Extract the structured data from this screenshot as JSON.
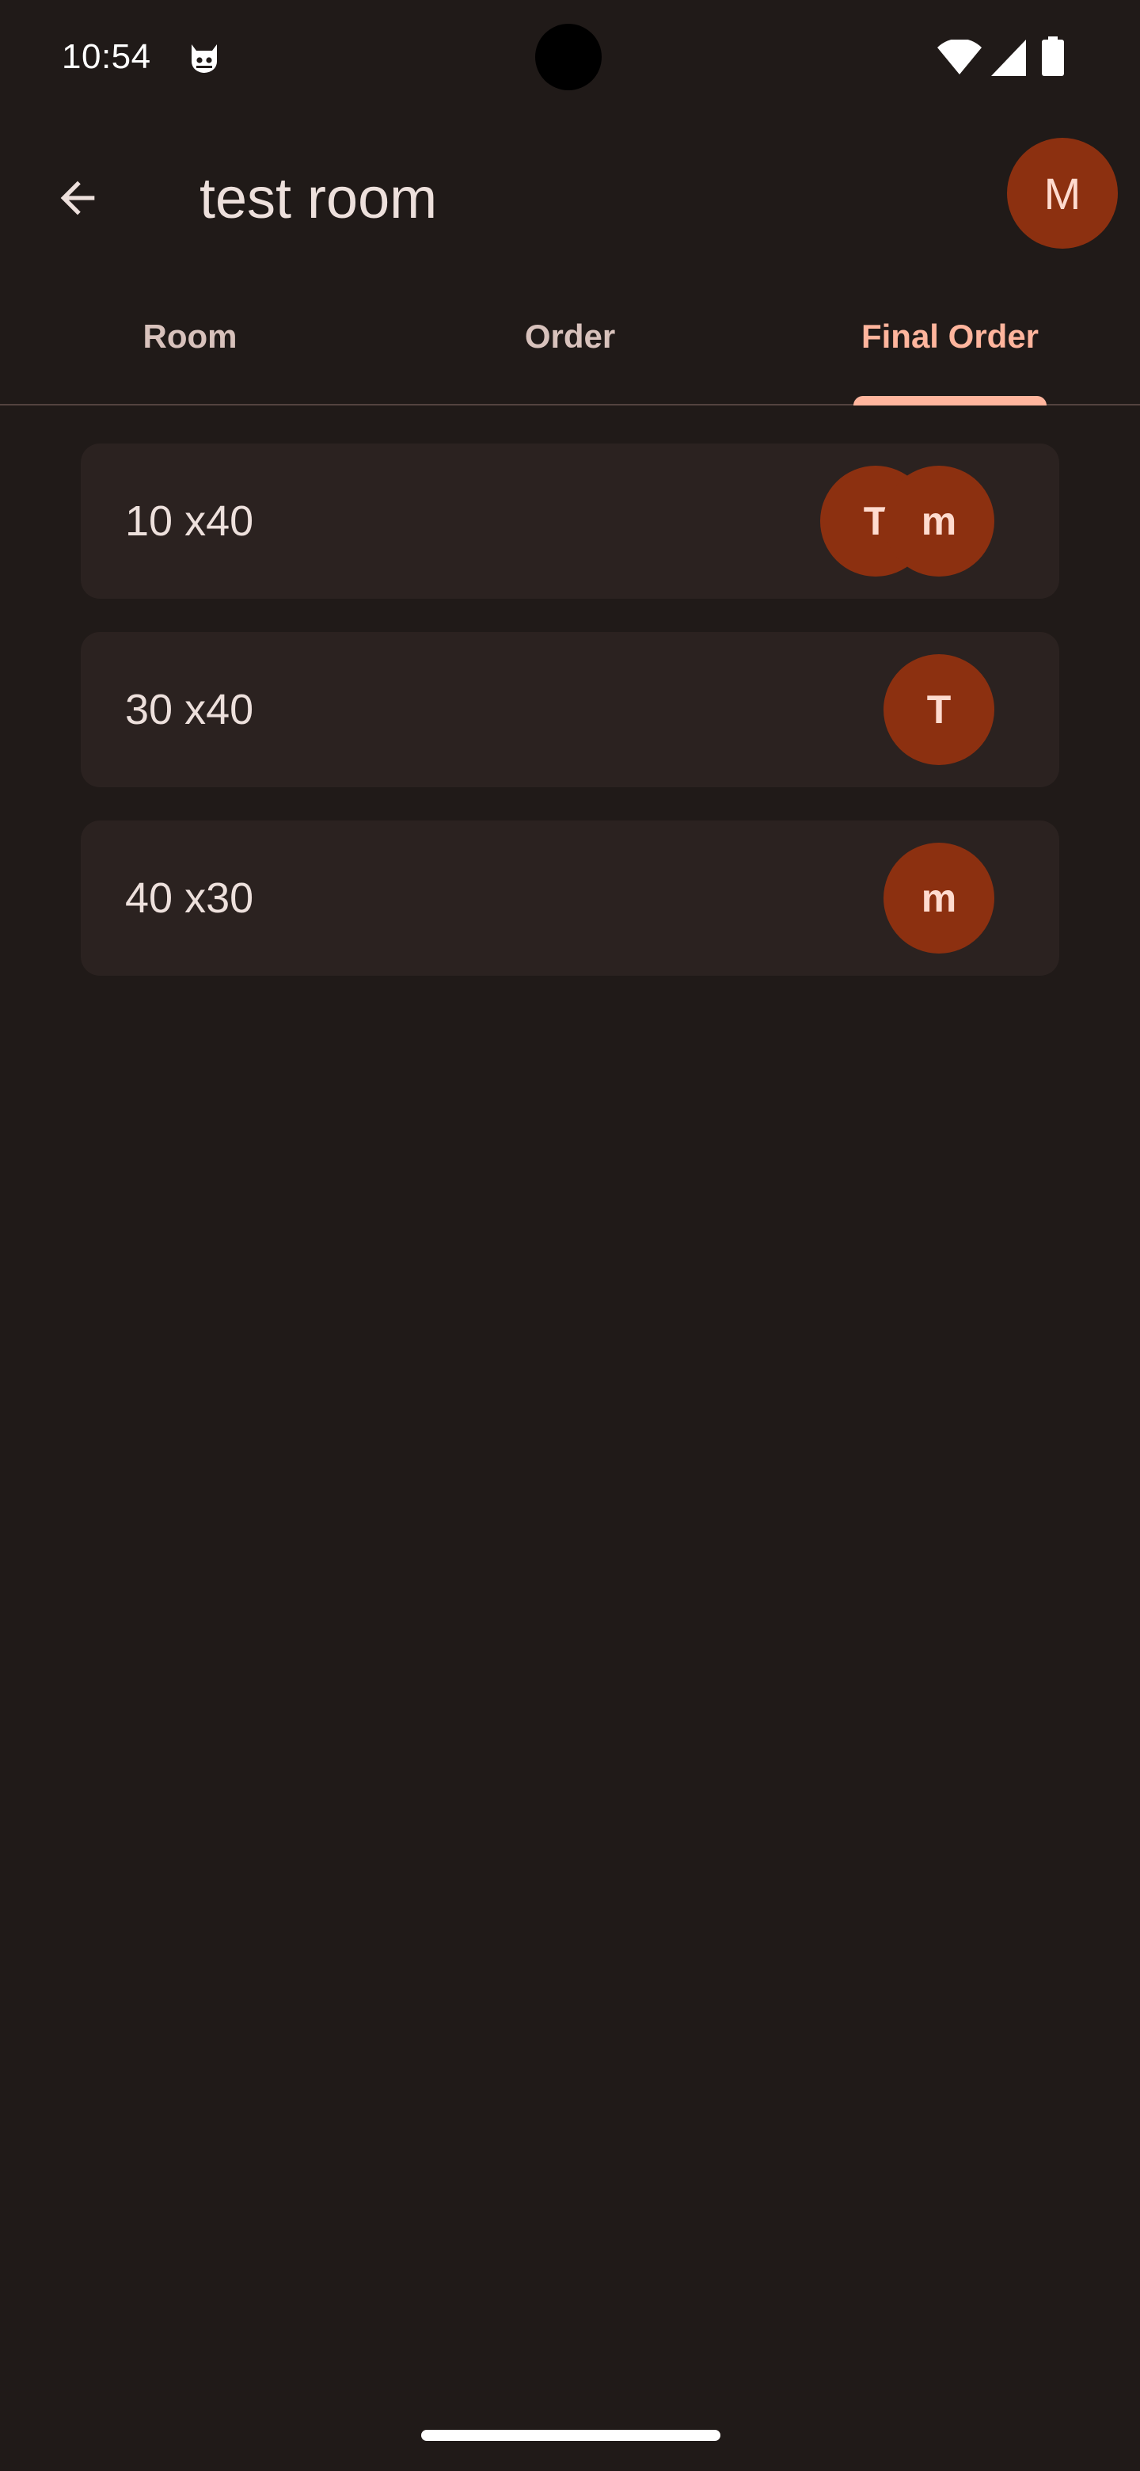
{
  "status_bar": {
    "time": "10:54"
  },
  "app_bar": {
    "title": "test room",
    "back_icon": "arrow-back-icon",
    "profile_initial": "M"
  },
  "tabs": [
    {
      "label": "Room",
      "active": false
    },
    {
      "label": "Order",
      "active": false
    },
    {
      "label": "Final Order",
      "active": true
    }
  ],
  "orders": [
    {
      "label": "10 x40",
      "users": [
        "T",
        "m"
      ]
    },
    {
      "label": "30 x40",
      "users": [
        "T"
      ]
    },
    {
      "label": "40 x30",
      "users": [
        "m"
      ]
    }
  ],
  "colors": {
    "background": "#201a18",
    "card": "#2b2220",
    "avatar": "#8c3010",
    "accent": "#ffb59d"
  }
}
